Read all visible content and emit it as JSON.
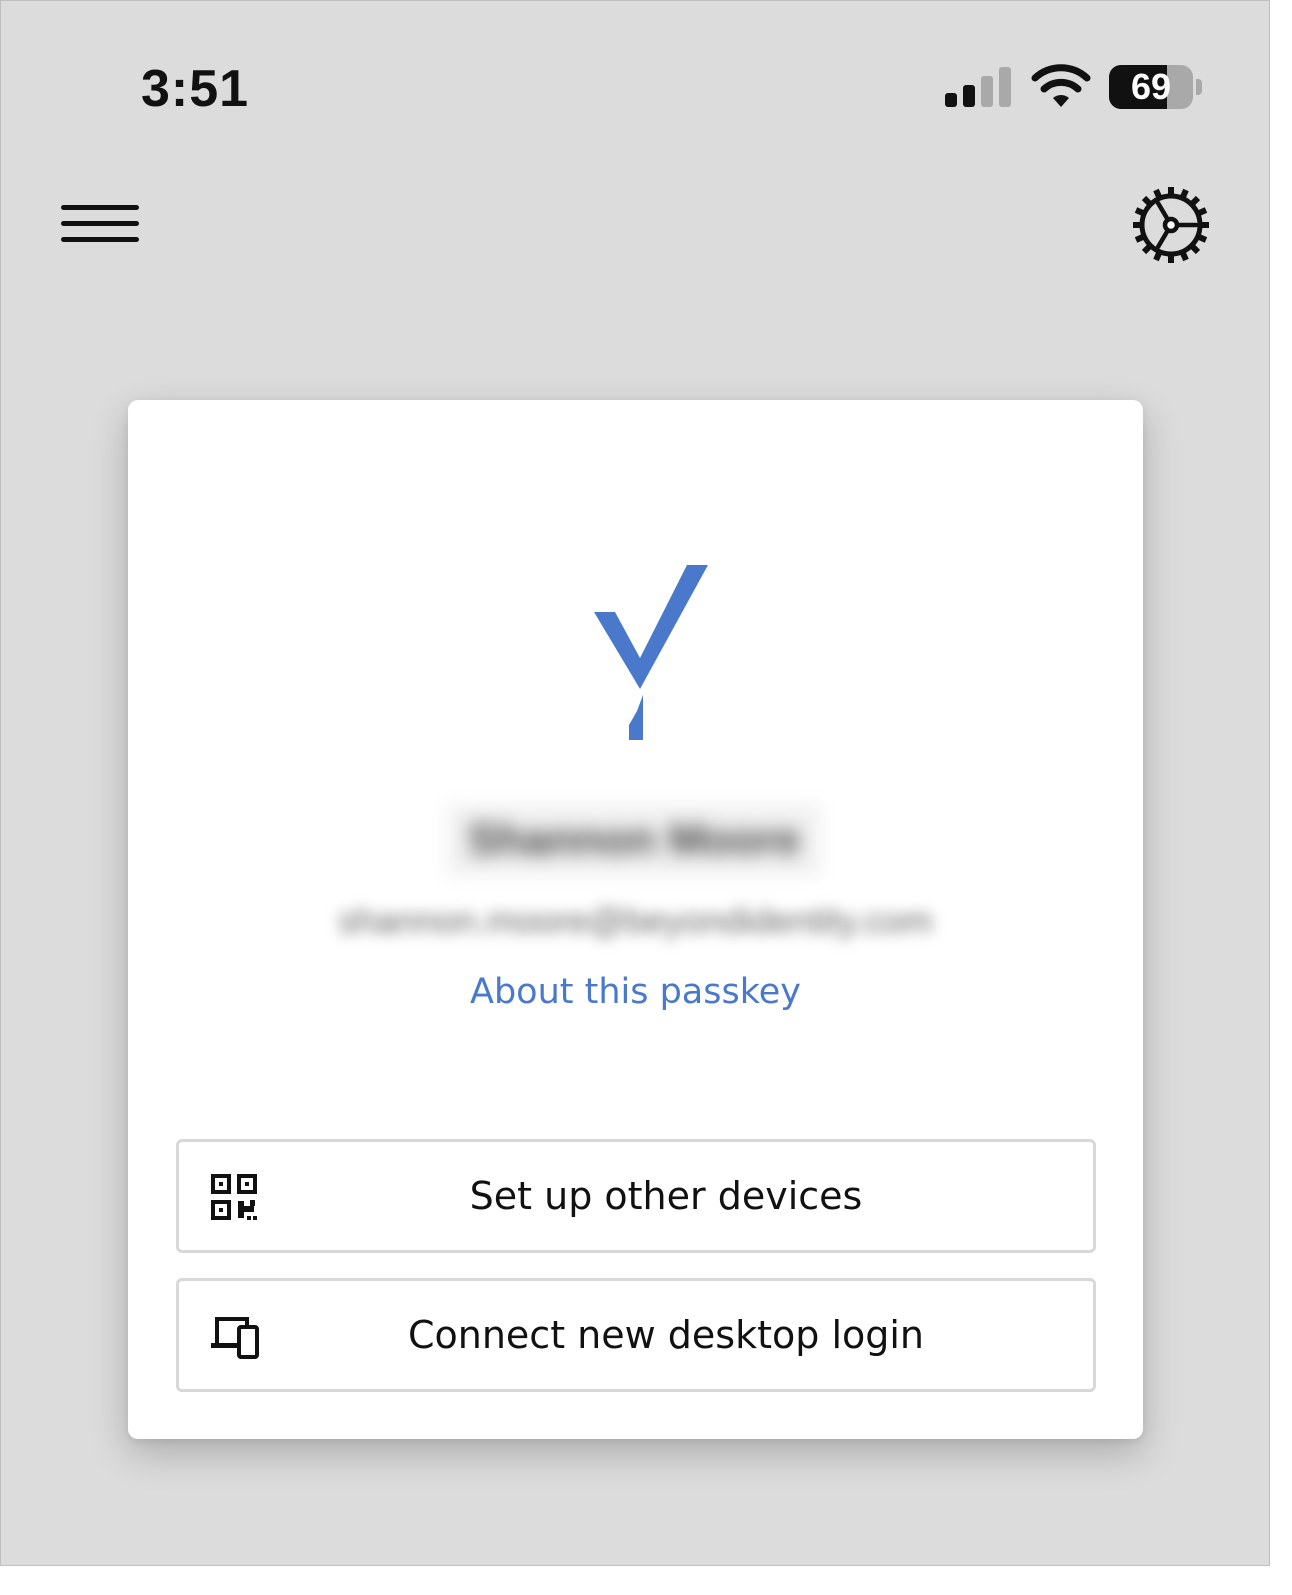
{
  "status_bar": {
    "time": "3:51",
    "battery_percent": "69",
    "battery_level": 0.69,
    "signal_bars_active": 2,
    "signal_bars_total": 4,
    "icons": [
      "signal-icon",
      "wifi-icon",
      "battery-icon"
    ]
  },
  "nav": {
    "left_icon": "menu-icon",
    "right_icon": "settings-icon"
  },
  "card": {
    "logo_icon": "passkey-logo",
    "logo_color": "#4a79cc",
    "user_name": "Shannon Moore",
    "user_email": "shannon.moore@beyondidentity.com",
    "about_link": "About this passkey",
    "buttons": [
      {
        "label": "Set up other devices",
        "icon": "qr-code-icon"
      },
      {
        "label": "Connect new desktop login",
        "icon": "devices-icon"
      }
    ]
  },
  "colors": {
    "background": "#dcdcdc",
    "card": "#ffffff",
    "accent": "#4a79cc",
    "text": "#111111"
  }
}
